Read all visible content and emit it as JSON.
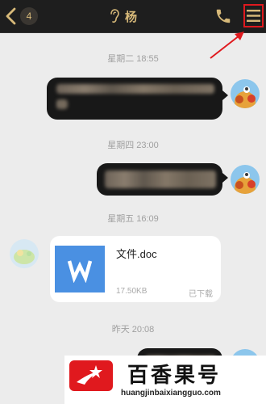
{
  "header": {
    "badge_count": "4",
    "contact_name": "杨",
    "back_icon": "chevron-left-icon",
    "phone_icon": "phone-icon",
    "menu_icon": "hamburger-menu-icon",
    "accent_color": "#d7b979",
    "highlight_color": "#e0191e"
  },
  "messages": [
    {
      "timestamp": "星期二 18:55",
      "direction": "outgoing",
      "type": "text",
      "content": "[blurred]"
    },
    {
      "timestamp": "星期四 23:00",
      "direction": "outgoing",
      "type": "text",
      "content": "[blurred]"
    },
    {
      "timestamp": "星期五 16:09",
      "direction": "incoming",
      "type": "file",
      "file": {
        "name": "文件.doc",
        "size": "17.50KB",
        "status": "已下载",
        "icon": "word-file-icon",
        "icon_color": "#4a90e2"
      }
    },
    {
      "timestamp": "昨天 20:08",
      "direction": "outgoing",
      "type": "text",
      "content": "[blurred]"
    }
  ],
  "watermark": {
    "brand": "百香果号",
    "url": "huangjinbaixiangguo.com",
    "logo_icon": "star-logo-icon",
    "logo_color": "#e0191e"
  }
}
